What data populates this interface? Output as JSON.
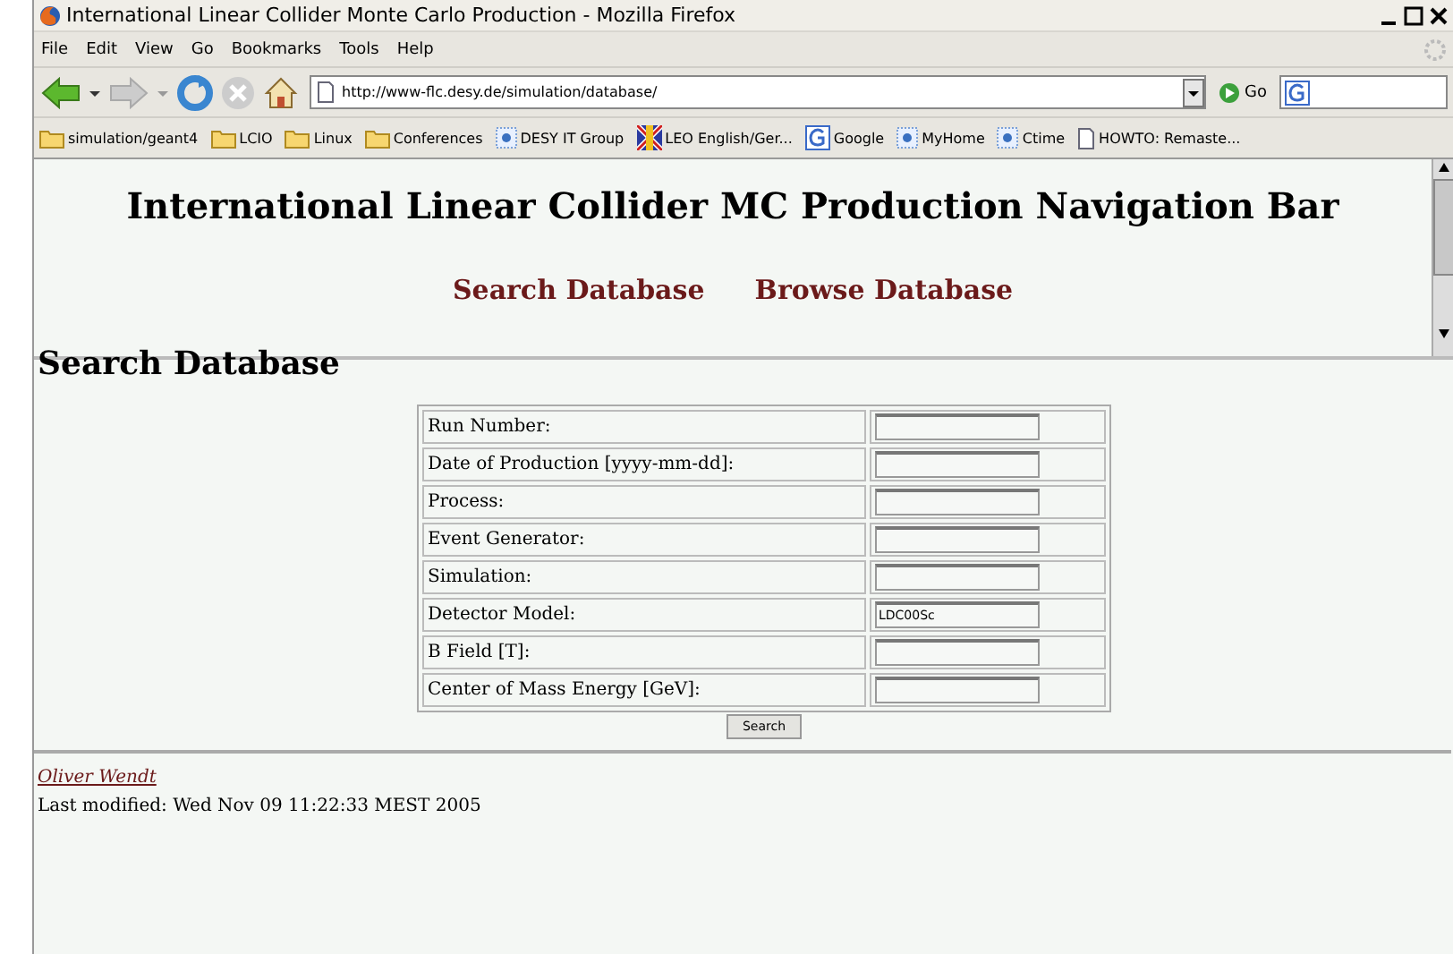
{
  "window": {
    "title": "International Linear Collider Monte Carlo Production - Mozilla Firefox"
  },
  "menu": [
    "File",
    "Edit",
    "View",
    "Go",
    "Bookmarks",
    "Tools",
    "Help"
  ],
  "toolbar": {
    "url": "http://www-flc.desy.de/simulation/database/",
    "go": "Go"
  },
  "bookmarks": [
    {
      "kind": "folder",
      "label": "simulation/geant4"
    },
    {
      "kind": "folder",
      "label": "LCIO"
    },
    {
      "kind": "folder",
      "label": "Linux"
    },
    {
      "kind": "folder",
      "label": "Conferences"
    },
    {
      "kind": "site",
      "label": "DESY IT Group"
    },
    {
      "kind": "flag",
      "label": "LEO English/Ger..."
    },
    {
      "kind": "google",
      "label": "Google"
    },
    {
      "kind": "site",
      "label": "MyHome"
    },
    {
      "kind": "site",
      "label": "Ctime"
    },
    {
      "kind": "page",
      "label": "HOWTO: Remaste..."
    }
  ],
  "nav_frame": {
    "title": "International Linear Collider MC Production Navigation Bar",
    "links": [
      "Search Database",
      "Browse Database"
    ]
  },
  "main": {
    "heading": "Search Database",
    "form": [
      {
        "label": "Run Number:"
      },
      {
        "label": "Date of Production [yyyy-mm-dd]:"
      },
      {
        "label": "Process:"
      },
      {
        "label": "Event Generator:"
      },
      {
        "label": "Simulation:"
      },
      {
        "label": "Detector Model:",
        "value": "LDC00Sc"
      },
      {
        "label": "B Field [T]:"
      },
      {
        "label": "Center of Mass Energy [GeV]:"
      }
    ],
    "button": "Search",
    "author": "Oliver Wendt",
    "modified": "Last modified: Wed Nov 09 11:22:33 MEST 2005"
  }
}
